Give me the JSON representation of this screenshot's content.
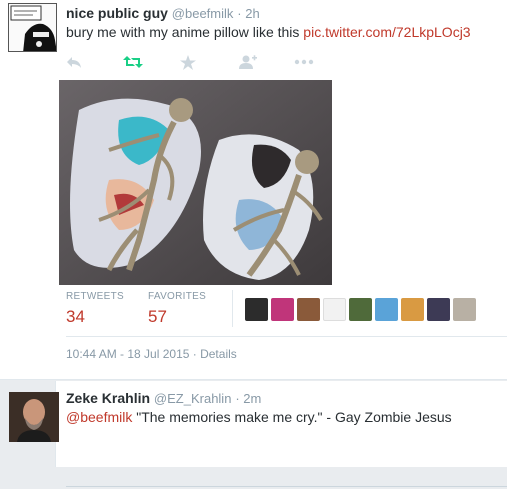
{
  "tweet": {
    "name": "nice public guy",
    "handle": "@beefmilk",
    "time": "· 2h",
    "text": "bury me with my anime pillow like this ",
    "link": "pic.twitter.com/72LkpLOcj3",
    "actions": [
      {
        "icon": "reply-icon"
      },
      {
        "icon": "retweet-icon",
        "color": "#19cf86"
      },
      {
        "icon": "favorite-icon"
      },
      {
        "icon": "follow-icon"
      },
      {
        "icon": "more-icon"
      }
    ],
    "stats": {
      "retweets_label": "RETWEETS",
      "retweets": "34",
      "favorites_label": "FAVORITES",
      "favorites": "57"
    },
    "timestamp": "10:44 AM - 18 Jul 2015",
    "details": "· Details"
  },
  "reply": {
    "name": "Zeke Krahlin",
    "handle": "@EZ_Krahlin",
    "time": "· 2m",
    "mention": "@beefmilk",
    "text": " \"The memories make me cry.\" - Gay Zombie Jesus"
  },
  "colors": {
    "link": "#c0392b",
    "muted": "#8899a6",
    "retweet": "#19cf86"
  }
}
